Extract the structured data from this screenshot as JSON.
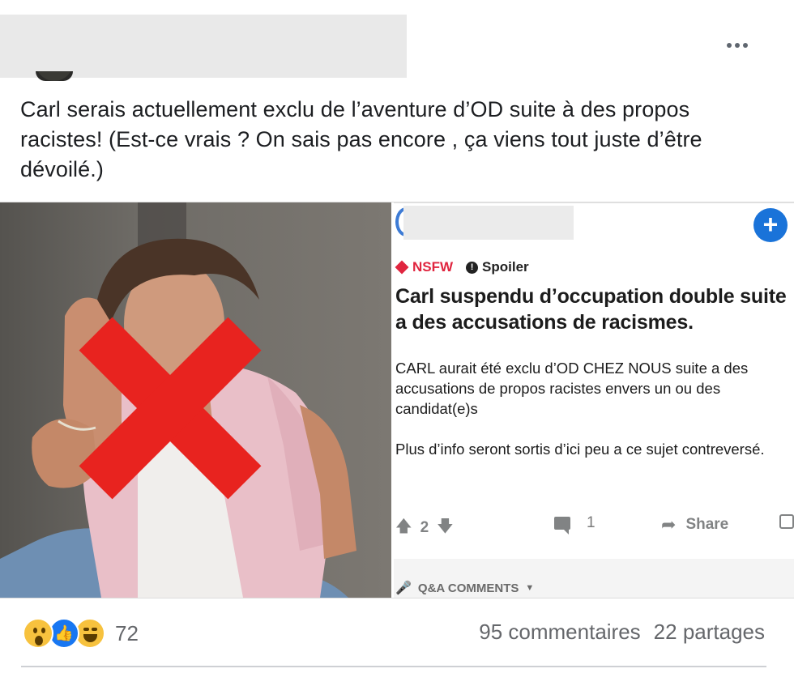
{
  "post": {
    "author_redacted": "",
    "more_icon": "ellipsis-icon",
    "text": "Carl serais actuellement exclu de l’aventure d’OD suite à des propos racistes! (Est-ce vrais ? On sais pas encore , ça viens tout juste d’être dévoilé.)"
  },
  "reddit": {
    "join_icon": "plus-icon",
    "join_symbol": "+",
    "tag_nsfw": "NSFW",
    "tag_spoiler": "Spoiler",
    "tag_spoiler_symbol": "!",
    "title": "Carl suspendu d’occupation double suite a des accusations de racismes.",
    "body": [
      "CARL aurait été exclu d’OD CHEZ NOUS suite a des accusations de propos racistes envers un ou des candidat(e)s",
      "Plus d’info seront sortis d’ici peu a ce sujet contreversé."
    ],
    "upvote_symbol": "🡅",
    "downvote_symbol": "🡇",
    "votes": "2",
    "comments": "1",
    "share_symbol": "➦",
    "share_label": "Share",
    "qa_label": "Q&A COMMENTS",
    "qa_caret": "▼",
    "mic_symbol": "🎤"
  },
  "footer": {
    "reactions": [
      "wow-reaction-icon",
      "like-reaction-icon",
      "haha-reaction-icon"
    ],
    "reaction_count": "72",
    "like_symbol": "👍",
    "comments_label": "95 commentaires",
    "shares_label": "22 partages"
  },
  "colors": {
    "facebook_blue": "#1877f2",
    "reddit_join_blue": "#1a73d9",
    "nsfw_red": "#e0253f",
    "cross_red": "#e8231f",
    "secondary_text": "#65676b"
  }
}
